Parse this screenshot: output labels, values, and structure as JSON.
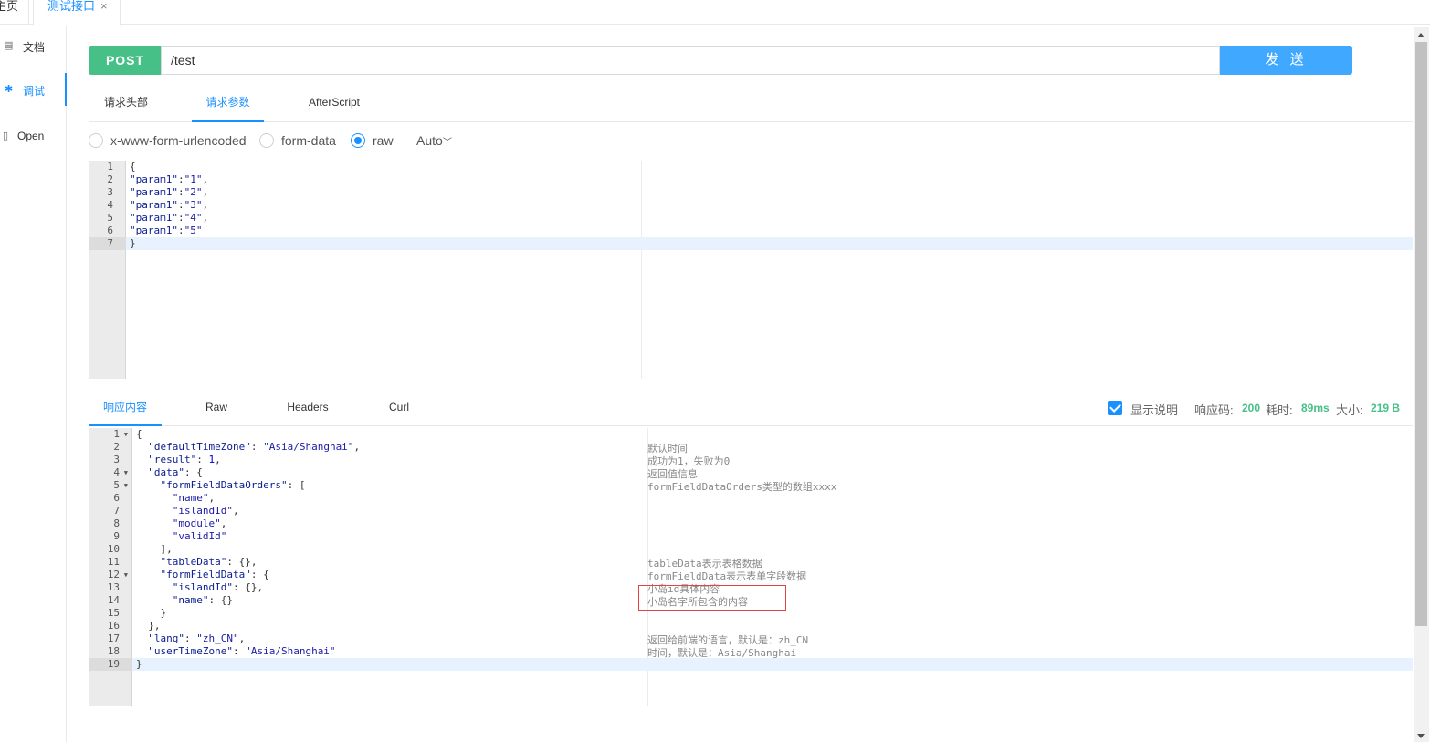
{
  "top_tabs": {
    "home": "主页",
    "active": "测试接口",
    "close": "×"
  },
  "sidebar": [
    {
      "label": "文档",
      "icon": "document-icon"
    },
    {
      "label": "调试",
      "icon": "bug-icon"
    },
    {
      "label": "Open",
      "icon": "file-icon"
    }
  ],
  "request": {
    "method": "POST",
    "url": "/test",
    "send": "发 送"
  },
  "request_tabs": [
    "请求头部",
    "请求参数",
    "AfterScript"
  ],
  "body_types": {
    "urlencoded": "x-www-form-urlencoded",
    "formdata": "form-data",
    "raw": "raw",
    "auto": "Auto"
  },
  "request_body": {
    "lines": [
      "{",
      "\"param1\":\"1\",",
      "\"param1\":\"2\",",
      "\"param1\":\"3\",",
      "\"param1\":\"4\",",
      "\"param1\":\"5\"",
      "}"
    ]
  },
  "response_tabs": [
    "响应内容",
    "Raw",
    "Headers",
    "Curl"
  ],
  "response_meta": {
    "show_desc": "显示说明",
    "code_label": "响应码:",
    "code": "200",
    "time_label": "耗时:",
    "time": "89ms",
    "size_label": "大小:",
    "size": "219 B"
  },
  "response_body": {
    "lines": [
      "{",
      "  \"defaultTimeZone\": \"Asia/Shanghai\",",
      "  \"result\": 1,",
      "  \"data\": {",
      "    \"formFieldDataOrders\": [",
      "      \"name\",",
      "      \"islandId\",",
      "      \"module\",",
      "      \"validId\"",
      "    ],",
      "    \"tableData\": {},",
      "    \"formFieldData\": {",
      "      \"islandId\": {},",
      "      \"name\": {}",
      "    }",
      "  },",
      "  \"lang\": \"zh_CN\",",
      "  \"userTimeZone\": \"Asia/Shanghai\"",
      "}"
    ],
    "descriptions": {
      "2": "默认时间",
      "3": "成功为1，失败为0",
      "4": "返回值信息",
      "5": "formFieldDataOrders类型的数组xxxx",
      "11": "tableData表示表格数据",
      "12": "formFieldData表示表单字段数据",
      "13": "小岛id具体内容",
      "14": "小岛名字所包含的内容",
      "17": "返回给前端的语言，默认是：zh_CN",
      "18": "时间，默认是：Asia/Shanghai"
    }
  }
}
